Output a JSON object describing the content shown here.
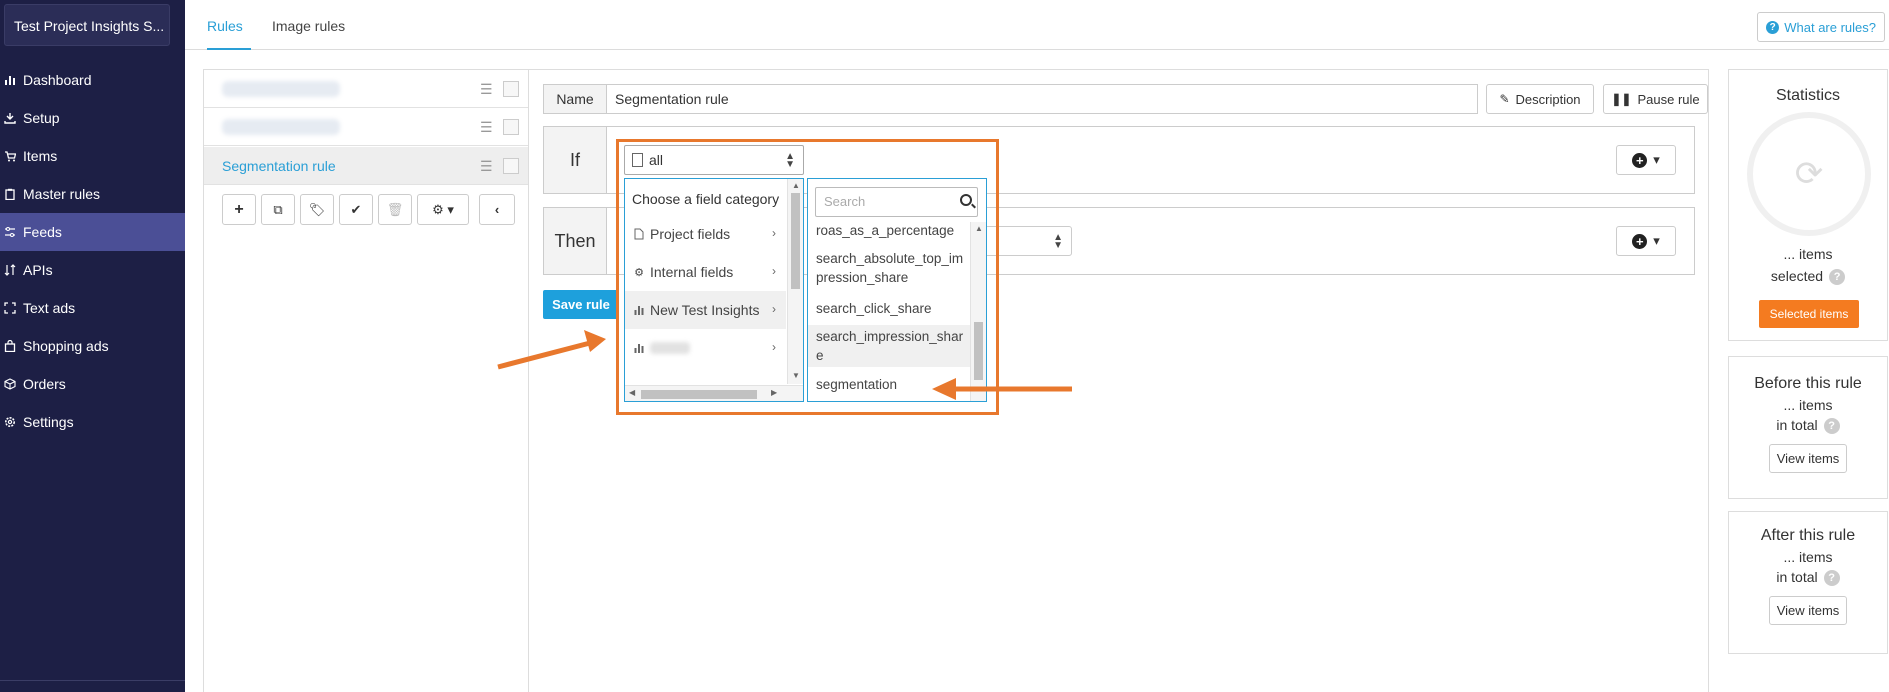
{
  "project": {
    "name": "Test Project Insights S..."
  },
  "sidebar": {
    "items": [
      {
        "label": "Dashboard",
        "icon": "bar-chart-icon",
        "active": false
      },
      {
        "label": "Setup",
        "icon": "download-icon",
        "active": false
      },
      {
        "label": "Items",
        "icon": "cart-icon",
        "active": false
      },
      {
        "label": "Master rules",
        "icon": "clipboard-icon",
        "active": false
      },
      {
        "label": "Feeds",
        "icon": "sliders-icon",
        "active": true
      },
      {
        "label": "APIs",
        "icon": "sort-icon",
        "active": false
      },
      {
        "label": "Text ads",
        "icon": "expand-icon",
        "active": false
      },
      {
        "label": "Shopping ads",
        "icon": "bag-icon",
        "active": false
      },
      {
        "label": "Orders",
        "icon": "box-icon",
        "active": false
      },
      {
        "label": "Settings",
        "icon": "gear-icon",
        "active": false
      }
    ]
  },
  "tabs": {
    "rules": "Rules",
    "image_rules": "Image rules",
    "what_are_rules": "What are rules?"
  },
  "rules_list": {
    "selected_rule": "Segmentation rule"
  },
  "editor": {
    "name_label": "Name",
    "name_value": "Segmentation rule",
    "description_button": "Description",
    "pause_button": "Pause rule",
    "if_label": "If",
    "then_label": "Then",
    "save_button": "Save rule",
    "condition_select": "all"
  },
  "category_menu": {
    "header": "Choose a field category",
    "items": [
      {
        "label": "Project fields",
        "icon": "file-icon"
      },
      {
        "label": "Internal fields",
        "icon": "gear-icon"
      },
      {
        "label": "New Test Insights",
        "icon": "bar-chart-icon"
      }
    ]
  },
  "field_menu": {
    "search_placeholder": "Search",
    "items": [
      "roas_as_a_percentage",
      "search_absolute_top_im pression_share",
      "search_click_share",
      "search_impression_shar e",
      "segmentation"
    ]
  },
  "stats": {
    "title": "Statistics",
    "items_line": "... items",
    "selected_line": "selected",
    "selected_button": "Selected items",
    "before_title": "Before this rule",
    "before_items": "... items",
    "before_total": "in total",
    "after_title": "After this rule",
    "after_items": "... items",
    "after_total": "in total",
    "view_items": "View items"
  },
  "colors": {
    "sidebar_bg": "#1d1f45",
    "sidebar_active": "#4b4f96",
    "accent": "#2a9fd6",
    "highlight": "#e8782d",
    "orange_button": "#f47b20"
  }
}
